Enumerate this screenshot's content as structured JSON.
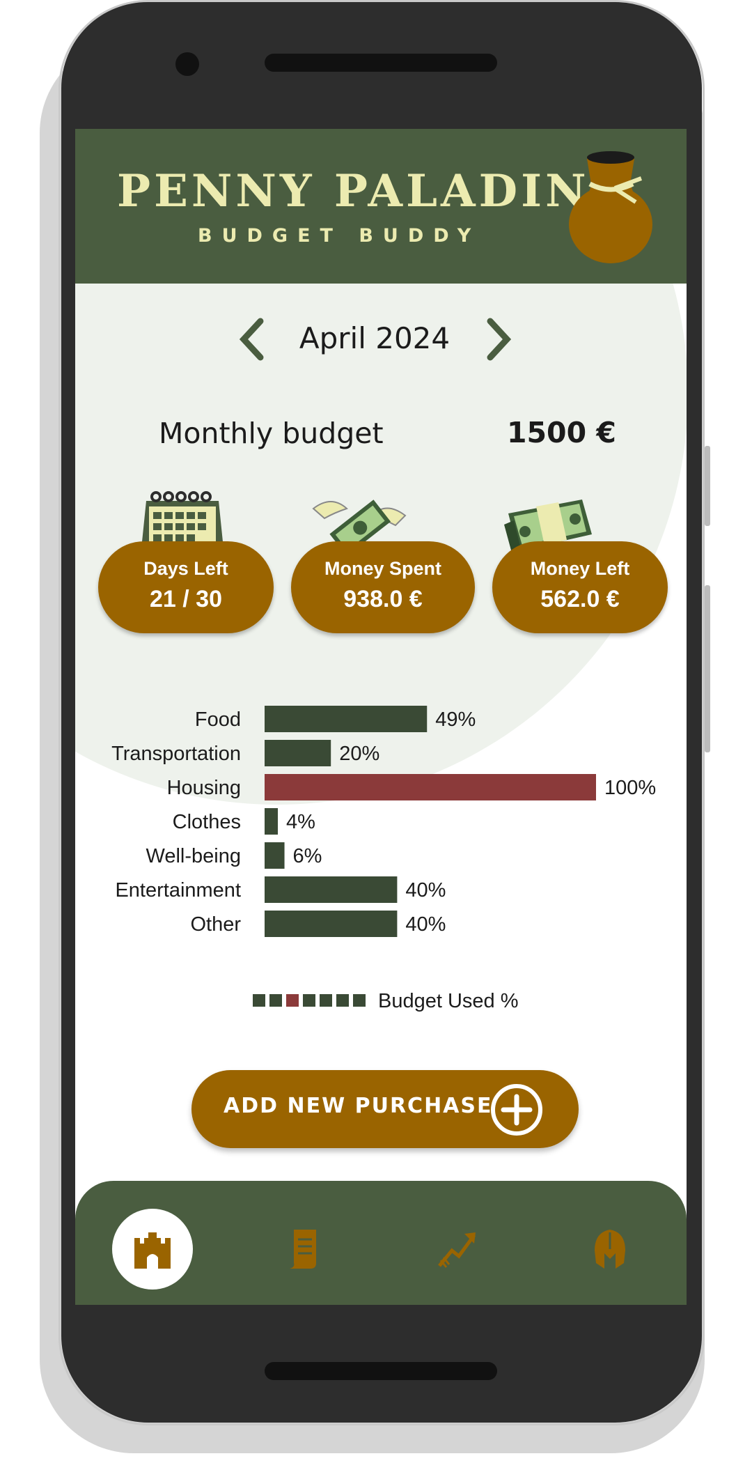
{
  "header": {
    "title": "PENNY PALADIN",
    "subtitle": "BUDGET BUDDY",
    "logo_icon": "money-bag-icon"
  },
  "month_nav": {
    "label": "April 2024",
    "prev_icon": "chevron-left-icon",
    "next_icon": "chevron-right-icon"
  },
  "budget": {
    "label": "Monthly budget",
    "value": "1500 €"
  },
  "stats": [
    {
      "label": "Days Left",
      "value": "21 / 30",
      "icon": "calendar-icon"
    },
    {
      "label": "Money Spent",
      "value": "938.0 €",
      "icon": "flying-money-icon"
    },
    {
      "label": "Money Left",
      "value": "562.0 €",
      "icon": "cash-stack-icon"
    }
  ],
  "chart_data": {
    "type": "bar",
    "orientation": "horizontal",
    "categories": [
      "Food",
      "Transportation",
      "Housing",
      "Clothes",
      "Well-being",
      "Entertainment",
      "Other"
    ],
    "values": [
      49,
      20,
      100,
      4,
      6,
      40,
      40
    ],
    "value_labels": [
      "49%",
      "20%",
      "100%",
      "4%",
      "6%",
      "40%",
      "40%"
    ],
    "colors": [
      "#3a4a35",
      "#3a4a35",
      "#8b3a3a",
      "#3a4a35",
      "#3a4a35",
      "#3a4a35",
      "#3a4a35"
    ],
    "xlim": [
      0,
      100
    ],
    "legend": {
      "label": "Budget Used %",
      "placement": "bottom"
    }
  },
  "add_button": {
    "label": "ADD NEW PURCHASE",
    "icon": "plus-circle-icon"
  },
  "bottom_nav": [
    {
      "name": "castle",
      "icon": "castle-icon",
      "active": true
    },
    {
      "name": "scroll",
      "icon": "scroll-icon",
      "active": false
    },
    {
      "name": "trend",
      "icon": "trend-arrow-icon",
      "active": false
    },
    {
      "name": "helmet",
      "icon": "helmet-icon",
      "active": false
    }
  ],
  "colors": {
    "header_green": "#4a5d40",
    "accent_brown": "#9a6400",
    "cream": "#ecebb0",
    "bar_green": "#3a4a35",
    "bar_red": "#8b3a3a"
  }
}
